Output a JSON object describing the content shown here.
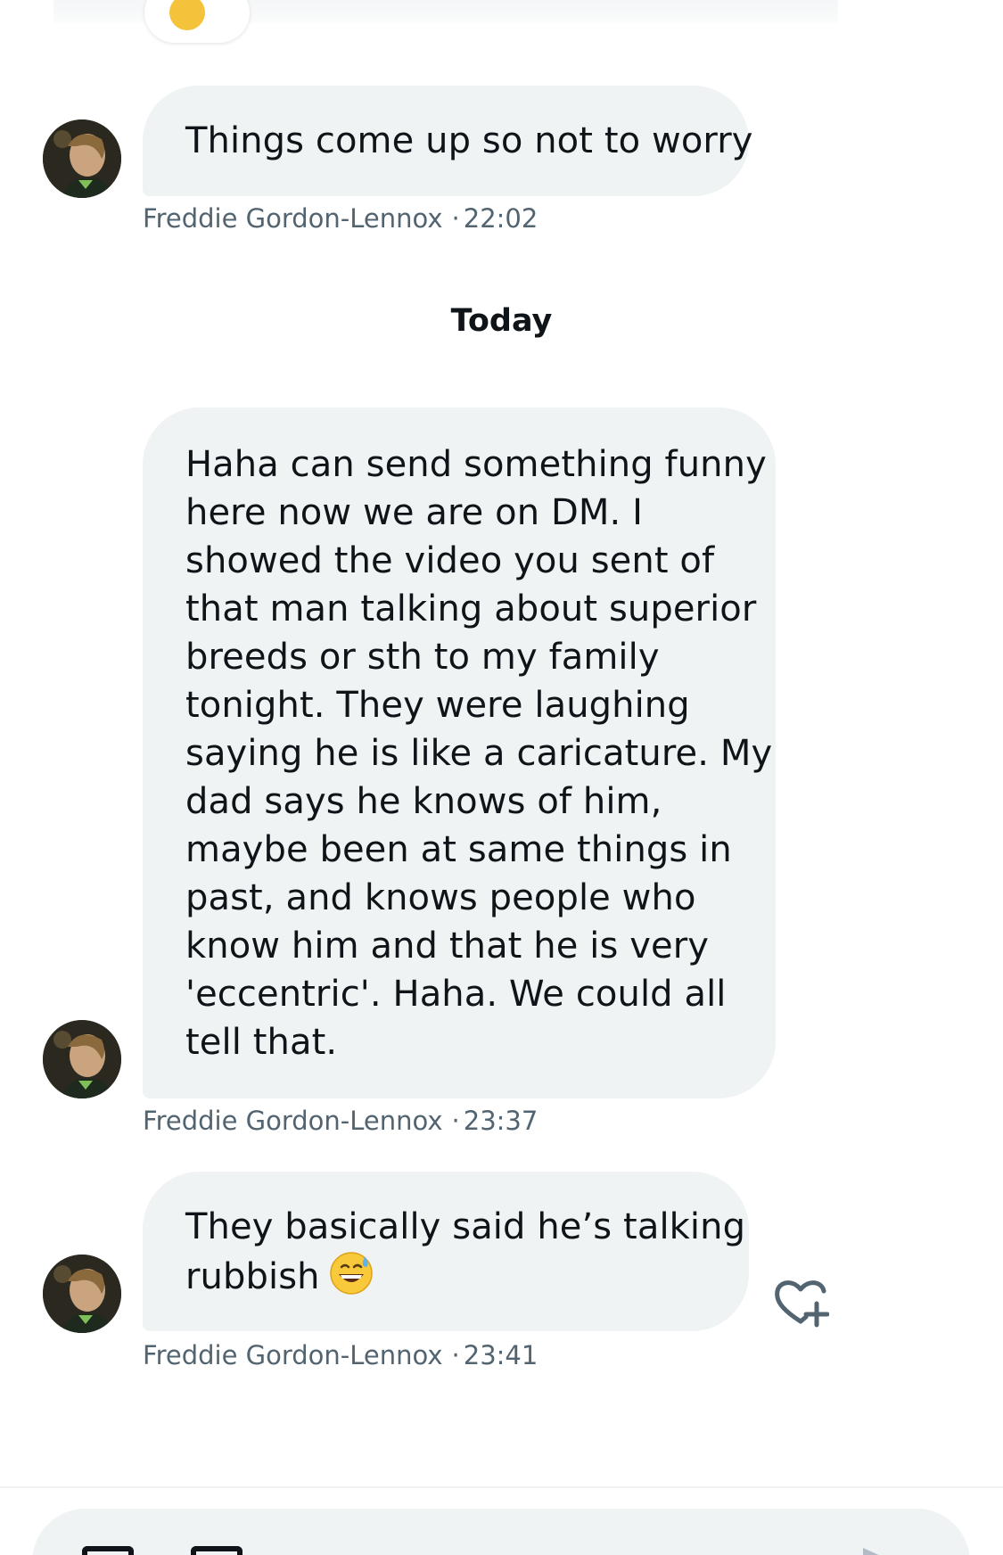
{
  "conversation": {
    "day_separator": "Today",
    "messages": [
      {
        "lines": [
          "Things come up so not to worry"
        ],
        "sender": "Freddie Gordon-Lennox",
        "separator": "·",
        "time": "22:02"
      },
      {
        "lines": [
          "Haha can send something funny",
          "here now we are on DM. I",
          "showed the video you sent of",
          "that man talking about superior",
          "breeds or sth to my family",
          "tonight. They were laughing",
          "saying he is like a caricature. My",
          "dad says he knows of him,",
          "maybe been at same things in",
          "past, and knows people who",
          "know him and that he is very",
          "'eccentric'. Haha. We could all",
          "tell that."
        ],
        "sender": "Freddie Gordon-Lennox",
        "separator": "·",
        "time": "23:37"
      },
      {
        "lines": [
          "They basically said he’s talking",
          "rubbish"
        ],
        "emoji": "grinning-face-with-sweat",
        "sender": "Freddie Gordon-Lennox",
        "separator": "·",
        "time": "23:41"
      }
    ]
  },
  "icons": {
    "avatar": "profile-photo",
    "reaction": "heart-plus-icon",
    "composer_left_1": "image-icon",
    "composer_left_2": "gif-icon",
    "composer_send": "send-icon"
  },
  "colors": {
    "bubble": "#eff3f4",
    "meta_text": "#536471",
    "text": "#0f1419"
  }
}
